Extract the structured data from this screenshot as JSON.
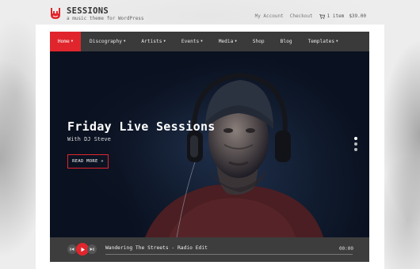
{
  "brand": {
    "title": "SESSIONS",
    "tagline": "a music theme for WordPress",
    "logo_icon": "rock-hand-icon",
    "accent_color": "#e0262c"
  },
  "header": {
    "my_account": "My Account",
    "checkout": "Checkout",
    "cart_icon": "cart-icon",
    "cart_count": "1 item",
    "cart_total": "$39.00"
  },
  "nav": {
    "items": [
      {
        "label": "Home",
        "dropdown": true,
        "active": true
      },
      {
        "label": "Discography",
        "dropdown": true,
        "active": false
      },
      {
        "label": "Artists",
        "dropdown": true,
        "active": false
      },
      {
        "label": "Events",
        "dropdown": true,
        "active": false
      },
      {
        "label": "Media",
        "dropdown": true,
        "active": false
      },
      {
        "label": "Shop",
        "dropdown": false,
        "active": false
      },
      {
        "label": "Blog",
        "dropdown": false,
        "active": false
      },
      {
        "label": "Templates",
        "dropdown": true,
        "active": false
      }
    ]
  },
  "hero": {
    "title": "Friday Live Sessions",
    "subtitle": "With DJ Steve",
    "button_label": "READ MORE »",
    "slides_total": 3,
    "active_slide": 1
  },
  "player": {
    "track_title": "Wandering The Streets - Radio Edit",
    "time": "00:00",
    "progress": 0,
    "icons": [
      "previous-icon",
      "play-icon",
      "next-icon"
    ]
  }
}
